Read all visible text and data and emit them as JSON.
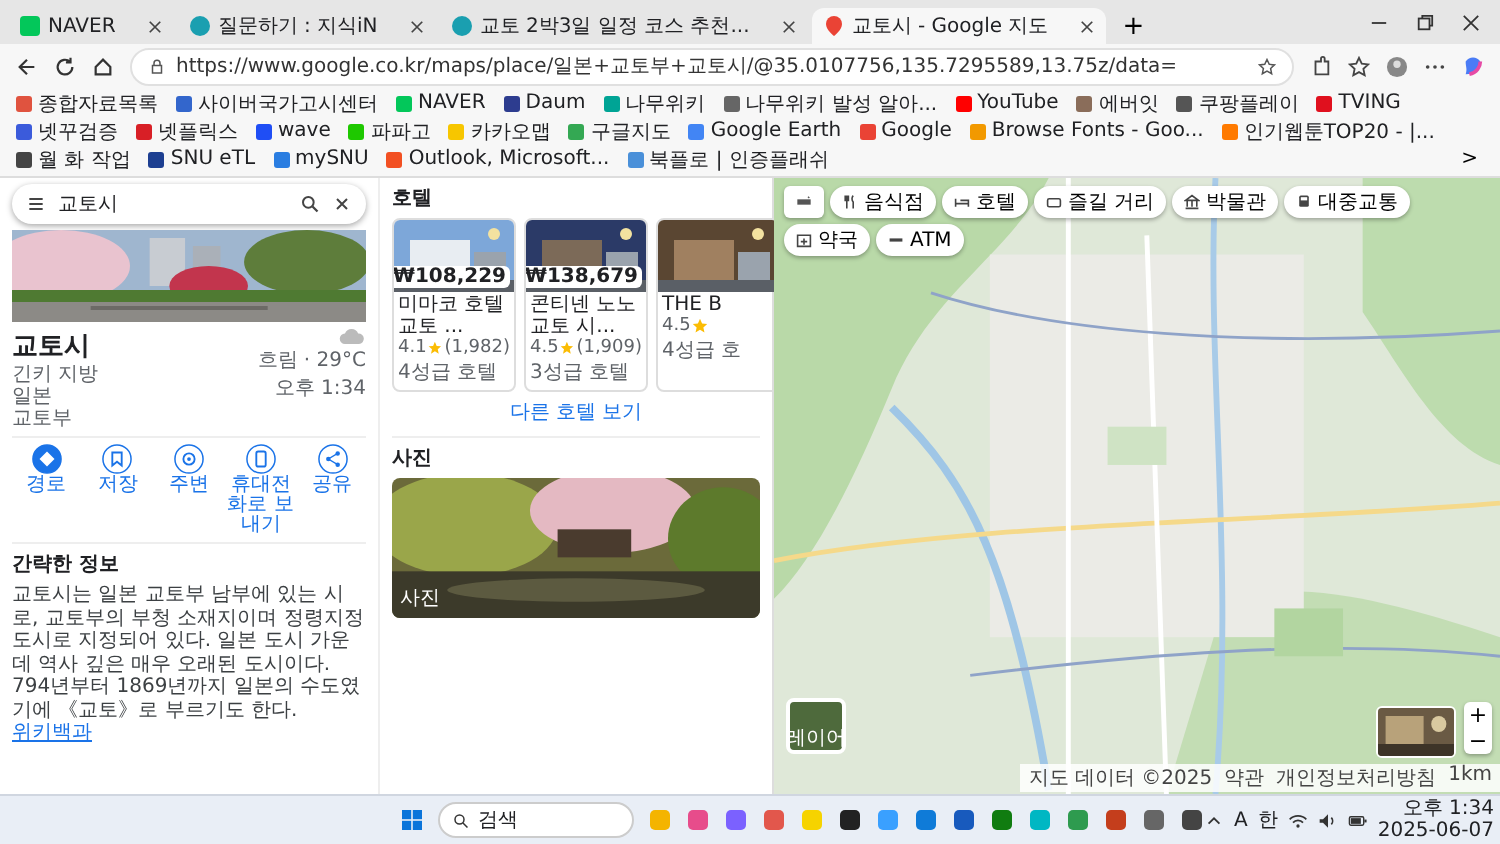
{
  "browser": {
    "tabs": [
      {
        "title": "NAVER",
        "selected": false
      },
      {
        "title": "질문하기 : 지식iN",
        "selected": false
      },
      {
        "title": "교토 2박3일 일정 코스 추천...",
        "selected": false
      },
      {
        "title": "교토시 - Google 지도",
        "selected": true
      }
    ],
    "new_tab": "+",
    "url": "https://www.google.co.kr/maps/place/일본+교토부+교토시/@35.0107756,135.7295589,13.75z/data=",
    "bookmarks": [
      {
        "label": "종합자료목록",
        "color": "#e0533f"
      },
      {
        "label": "사이버국가고시센터",
        "color": "#3366cc"
      },
      {
        "label": "NAVER",
        "color": "#03c75a"
      },
      {
        "label": "Daum",
        "color": "#2d3c8f"
      },
      {
        "label": "나무위키",
        "color": "#00a495"
      },
      {
        "label": "나무위키 발성 알아...",
        "color": "#666666"
      },
      {
        "label": "YouTube",
        "color": "#ff0000"
      },
      {
        "label": "에버잇",
        "color": "#8a6d5a"
      },
      {
        "label": "쿠팡플레이",
        "color": "#555555"
      },
      {
        "label": "TVING",
        "color": "#e0101e"
      },
      {
        "label": "넷꾸검증",
        "color": "#3b5bdb"
      },
      {
        "label": "넷플릭스",
        "color": "#d81f26"
      },
      {
        "label": "wave",
        "color": "#1f4ef5"
      },
      {
        "label": "파파고",
        "color": "#1ec800"
      },
      {
        "label": "카카오맵",
        "color": "#f7c600"
      },
      {
        "label": "구글지도",
        "color": "#34a853"
      },
      {
        "label": "Google Earth",
        "color": "#4285f4"
      },
      {
        "label": "Google",
        "color": "#ea4335"
      },
      {
        "label": "Browse Fonts - Goo...",
        "color": "#f29900"
      },
      {
        "label": "인기웹툰TOP20 - |...",
        "color": "#ff7a00"
      },
      {
        "label": "월 화 작업",
        "color": "#444444"
      },
      {
        "label": "SNU eTL",
        "color": "#1d3f91"
      },
      {
        "label": "mySNU",
        "color": "#2a7de1"
      },
      {
        "label": "Outlook, Microsoft...",
        "color": "#f25022"
      },
      {
        "label": "북플로 | 인증플래쉬",
        "color": "#4a90d9"
      }
    ],
    "more_bookmarks": ">"
  },
  "place": {
    "search": "교토시",
    "title": "교토시",
    "lines": [
      "긴키 지방",
      "일본",
      "교토부"
    ],
    "weather": "흐림 · 29°C",
    "time": "오후 1:34",
    "actions": [
      {
        "label": "경로",
        "kind": "directions",
        "filled": true
      },
      {
        "label": "저장",
        "kind": "save",
        "filled": false
      },
      {
        "label": "주변",
        "kind": "nearby",
        "filled": false
      },
      {
        "label": "휴대전화로 보내기",
        "kind": "phone",
        "filled": false
      },
      {
        "label": "공유",
        "kind": "share",
        "filled": false
      }
    ],
    "info_heading": "간략한 정보",
    "description": "교토시는 일본 교토부 남부에 있는 시로, 교토부의 부청 소재지이며 정령지정도시로 지정되어 있다. 일본 도시 가운데 역사 깊은 매우 오래된 도시이다. 794년부터 1869년까지 일본의 수도였기에 《교토》로 부르기도 한다.",
    "source_link": "위키백과",
    "hotels_heading": "호텔",
    "hotels": [
      {
        "price": "₩108,229",
        "name": "미마코 호텔 교토 ...",
        "rating": "4.1",
        "reviews": "(1,982)",
        "class": "4성급 호텔"
      },
      {
        "price": "₩138,679",
        "name": "콘티넨 노노 교토 시...",
        "rating": "4.5",
        "reviews": "(1,909)",
        "class": "3성급 호텔"
      },
      {
        "name": "THE B",
        "rating": "4.5",
        "class": "4성급 호"
      }
    ],
    "more_hotels": "다른 호텔 보기",
    "photos_heading": "사진",
    "photo_label": "사진"
  },
  "map": {
    "chips": [
      {
        "label": "음식점",
        "kind": "food"
      },
      {
        "label": "호텔",
        "kind": "bed"
      },
      {
        "label": "즐길 거리",
        "kind": "ticket"
      },
      {
        "label": "박물관",
        "kind": "museum"
      },
      {
        "label": "대중교통",
        "kind": "transit"
      },
      {
        "label": "약국",
        "kind": "pharmacy"
      },
      {
        "label": "ATM",
        "kind": "atm"
      }
    ],
    "layers": "레이어",
    "attribution": [
      "지도 데이터 ©2025",
      "약관",
      "개인정보처리방침",
      "1km"
    ],
    "zoom_in": "+",
    "zoom_out": "−"
  },
  "taskbar": {
    "search": "검색",
    "ime": [
      "A",
      "한"
    ],
    "time": "오후 1:34",
    "date": "2025-06-07"
  }
}
